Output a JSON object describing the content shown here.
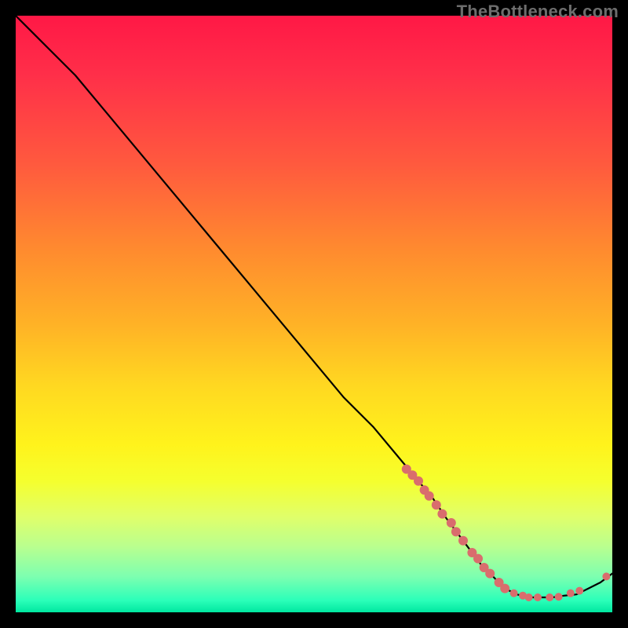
{
  "watermark": "TheBottleneck.com",
  "chart_data": {
    "type": "line",
    "title": "",
    "xlabel": "",
    "ylabel": "",
    "xlim": [
      0,
      100
    ],
    "ylim": [
      0,
      100
    ],
    "grid": false,
    "legend": false,
    "series": [
      {
        "name": "curve",
        "x": [
          0,
          3,
          6,
          10,
          15,
          20,
          25,
          30,
          35,
          40,
          45,
          50,
          55,
          60,
          65,
          70,
          72,
          75,
          78,
          80,
          82,
          84,
          86,
          88,
          90,
          92,
          94,
          96,
          98,
          100
        ],
        "y": [
          100,
          97,
          94,
          90,
          84,
          78,
          72,
          66,
          60,
          54,
          48,
          42,
          36,
          31,
          25,
          19,
          16,
          12,
          8,
          6,
          4,
          3,
          2.5,
          2.5,
          2.5,
          2.8,
          3,
          4,
          5,
          6.5
        ]
      }
    ],
    "points": {
      "name": "scatter-on-curve",
      "color": "#d96d6d",
      "radius_large": 6,
      "radius_small": 5,
      "data": [
        {
          "x": 65.5,
          "y": 24.0,
          "r": "large"
        },
        {
          "x": 66.5,
          "y": 23.0,
          "r": "large"
        },
        {
          "x": 67.5,
          "y": 22.0,
          "r": "large"
        },
        {
          "x": 68.5,
          "y": 20.5,
          "r": "large"
        },
        {
          "x": 69.3,
          "y": 19.5,
          "r": "large"
        },
        {
          "x": 70.5,
          "y": 18.0,
          "r": "large"
        },
        {
          "x": 71.5,
          "y": 16.5,
          "r": "large"
        },
        {
          "x": 73.0,
          "y": 15.0,
          "r": "large"
        },
        {
          "x": 73.8,
          "y": 13.5,
          "r": "large"
        },
        {
          "x": 75.0,
          "y": 12.0,
          "r": "large"
        },
        {
          "x": 76.5,
          "y": 10.0,
          "r": "large"
        },
        {
          "x": 77.5,
          "y": 9.0,
          "r": "large"
        },
        {
          "x": 78.5,
          "y": 7.5,
          "r": "large"
        },
        {
          "x": 79.5,
          "y": 6.5,
          "r": "large"
        },
        {
          "x": 81.0,
          "y": 5.0,
          "r": "large"
        },
        {
          "x": 82.0,
          "y": 4.0,
          "r": "large"
        },
        {
          "x": 83.5,
          "y": 3.2,
          "r": "small"
        },
        {
          "x": 85.0,
          "y": 2.8,
          "r": "small"
        },
        {
          "x": 86.0,
          "y": 2.5,
          "r": "small"
        },
        {
          "x": 87.5,
          "y": 2.5,
          "r": "small"
        },
        {
          "x": 89.5,
          "y": 2.5,
          "r": "small"
        },
        {
          "x": 91.0,
          "y": 2.6,
          "r": "small"
        },
        {
          "x": 93.0,
          "y": 3.2,
          "r": "small"
        },
        {
          "x": 94.5,
          "y": 3.6,
          "r": "small"
        },
        {
          "x": 99.0,
          "y": 6.0,
          "r": "small"
        }
      ]
    }
  }
}
